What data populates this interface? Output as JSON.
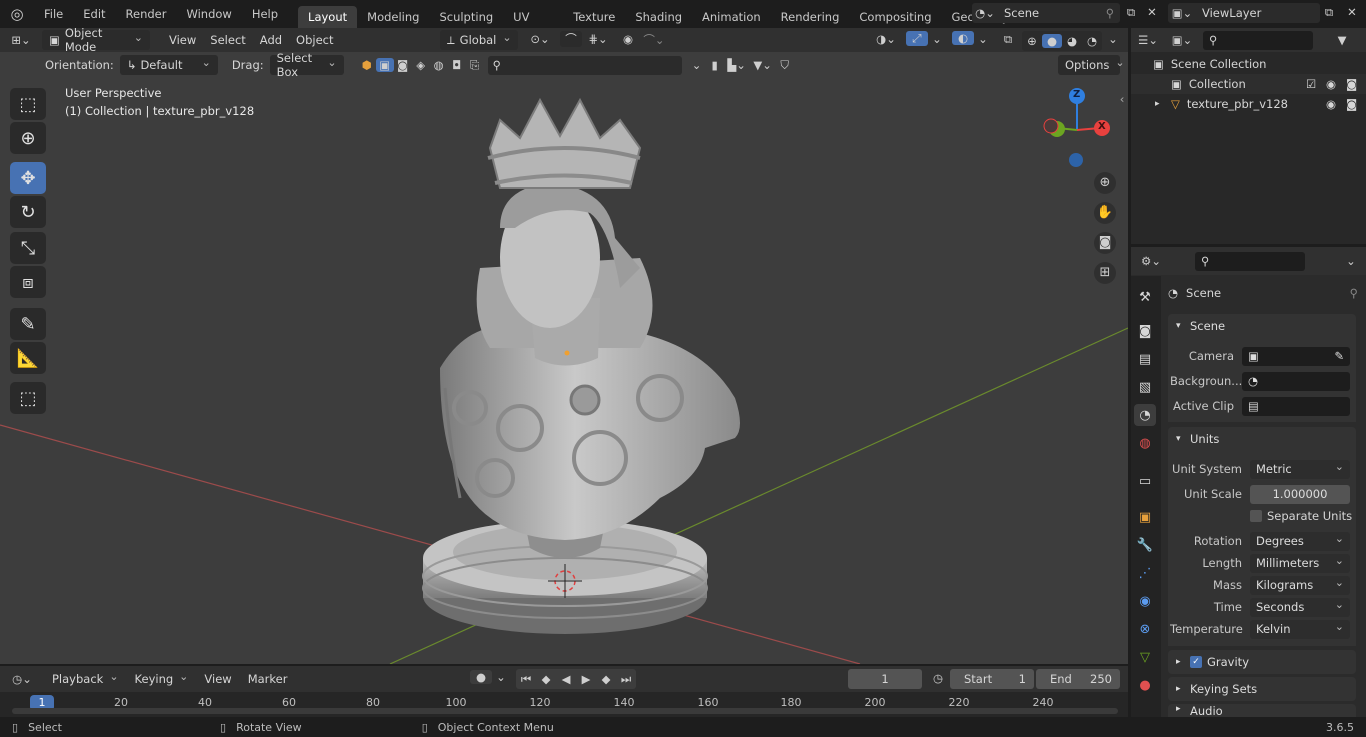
{
  "topbar": {
    "menus": [
      "File",
      "Edit",
      "Render",
      "Window",
      "Help"
    ],
    "workspaces": [
      "Layout",
      "Modeling",
      "Sculpting",
      "UV Editing",
      "Texture Paint",
      "Shading",
      "Animation",
      "Rendering",
      "Compositing",
      "Geometry Noc"
    ],
    "scene": "Scene",
    "view_layer": "ViewLayer"
  },
  "header": {
    "mode": "Object Mode",
    "menus": [
      "View",
      "Select",
      "Add",
      "Object"
    ],
    "transform_orientation": "Global",
    "orientation_label": "Orientation:",
    "orientation_value": "Default",
    "drag_label": "Drag:",
    "drag_value": "Select Box",
    "options_label": "Options"
  },
  "viewport": {
    "view_name": "User Perspective",
    "collection_info": "(1) Collection | texture_pbr_v128",
    "gizmo_axes": {
      "z": "Z",
      "x": "X"
    },
    "colors": {
      "x": "#e8413e",
      "y": "#6ca521",
      "z": "#2f7fe0",
      "bg": "#3d3d3d"
    }
  },
  "outliner": {
    "root": "Scene Collection",
    "items": [
      {
        "name": "Collection"
      },
      {
        "name": "texture_pbr_v128"
      }
    ]
  },
  "properties": {
    "title": "Scene",
    "sections": {
      "scene": {
        "label": "Scene",
        "camera_label": "Camera",
        "background_label": "Backgroun...",
        "active_clip_label": "Active Clip"
      },
      "units": {
        "label": "Units",
        "unit_system_label": "Unit System",
        "unit_system": "Metric",
        "unit_scale_label": "Unit Scale",
        "unit_scale": "1.000000",
        "separate_units": "Separate Units",
        "rotation_label": "Rotation",
        "rotation": "Degrees",
        "length_label": "Length",
        "length": "Millimeters",
        "mass_label": "Mass",
        "mass": "Kilograms",
        "time_label": "Time",
        "time": "Seconds",
        "temperature_label": "Temperature",
        "temperature": "Kelvin"
      },
      "gravity": "Gravity",
      "keying_sets": "Keying Sets",
      "audio": "Audio"
    }
  },
  "timeline": {
    "menus": [
      "Playback",
      "Keying",
      "View",
      "Marker"
    ],
    "current_frame": "1",
    "start_label": "Start",
    "start": "1",
    "end_label": "End",
    "end": "250",
    "ticks": [
      "1",
      "20",
      "40",
      "60",
      "80",
      "100",
      "120",
      "140",
      "160",
      "180",
      "200",
      "220",
      "240"
    ]
  },
  "statusbar": {
    "select": "Select",
    "rotate": "Rotate View",
    "context": "Object Context Menu",
    "version": "3.6.5"
  }
}
